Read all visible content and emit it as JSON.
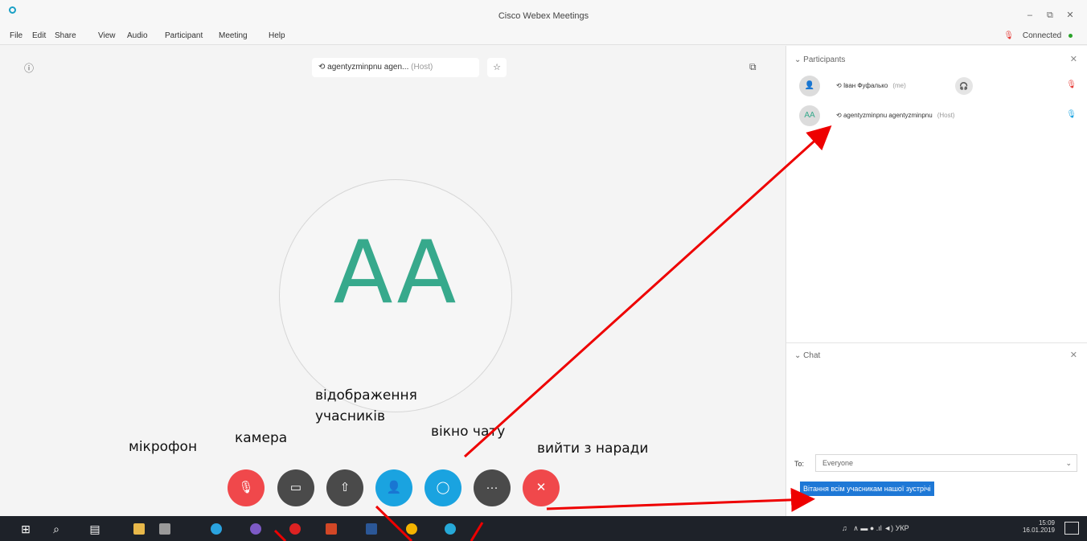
{
  "window": {
    "title": "Cisco Webex Meetings",
    "minimize": "–",
    "restore": "⧉",
    "close": "✕"
  },
  "menu": [
    "File",
    "Edit",
    "Share",
    "View",
    "Audio",
    "Participant",
    "Meeting",
    "Help"
  ],
  "connection": {
    "mic_icon": "mic-muted-icon",
    "status": "Connected"
  },
  "stage": {
    "host_name": "agentyzminpnu agen...",
    "host_role": "(Host)",
    "avatar_initials": "AA"
  },
  "annotations": {
    "participants": "відображення\nучасників",
    "chat": "вікно чату",
    "mic": "мікрофон",
    "camera": "камера",
    "leave": "вийти з наради"
  },
  "controls": [
    {
      "name": "mute-button",
      "icon": "mic-muted-icon",
      "color": "#f0484b"
    },
    {
      "name": "video-button",
      "icon": "video-icon",
      "color": "#4a4a4a"
    },
    {
      "name": "share-button",
      "icon": "share-icon",
      "color": "#4a4a4a"
    },
    {
      "name": "participants-button",
      "icon": "participants-icon",
      "color": "#1aa3e0"
    },
    {
      "name": "chat-button",
      "icon": "chat-icon",
      "color": "#1aa3e0"
    },
    {
      "name": "more-button",
      "icon": "more-icon",
      "color": "#4a4a4a"
    },
    {
      "name": "leave-button",
      "icon": "close-icon",
      "color": "#f0484b"
    }
  ],
  "participants_panel": {
    "title": "Participants",
    "items": [
      {
        "name": "Іван Фуфалько",
        "role": "(me)",
        "initials": ""
      },
      {
        "name": "agentyzminpnu agentyzminpnu",
        "role": "(Host)",
        "initials": "AA"
      }
    ]
  },
  "chat_panel": {
    "title": "Chat",
    "to_label": "To:",
    "to_value": "Everyone",
    "message": "Вітання всім учасникам нашої зустрічі"
  },
  "taskbar": {
    "time": "15:09",
    "date": "16.01.2019",
    "lang": "УКР"
  }
}
